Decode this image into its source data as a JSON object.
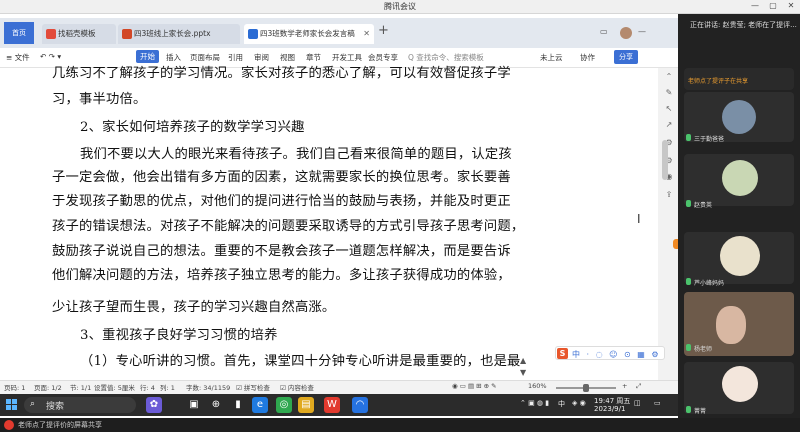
{
  "meeting": {
    "title": "腾讯会议",
    "minimize": "—",
    "maximize": "▢",
    "close": "✕"
  },
  "wps": {
    "home_tab": "首页",
    "tabs": [
      {
        "label": "找稻壳模板",
        "color": "#e24b3b"
      },
      {
        "label": "四3班线上家长会.pptx",
        "color": "#d24726"
      },
      {
        "label": "四3班数学老师家长会发言稿",
        "color": "#2b6cd4"
      }
    ],
    "tab_plus": "+",
    "menu_file": "≡ 文件",
    "menu": [
      "开始",
      "插入",
      "页面布局",
      "引用",
      "审阅",
      "视图",
      "章节",
      "开发工具",
      "会员专享"
    ],
    "search_hint": "Q 查找命令、搜索模板",
    "cloud": "未上云",
    "collab": "协作",
    "share": "分享"
  },
  "document": {
    "lines": [
      "几练习不了解孩子的学习情况。家长对孩子的悉心了解，可以有效督促孩子学",
      "习，事半功倍。",
      "2、家长如何培养孩子的数学学习兴趣",
      "我们不要以大人的眼光来看待孩子。我们自己看来很简单的题目，认定孩",
      "子一定会做，他会出错有多方面的因素，这就需要家长的换位思考。家长要善",
      "于发现孩子勤思的优点，对他们的提问进行恰当的鼓励与表扬，并能及时更正",
      "孩子的错误想法。对孩子不能解决的问题要采取诱导的方式引导孩子思考问题，",
      "鼓励孩子说说自己的想法。重要的不是教会孩子一道题怎样解决，而是要告诉",
      "他们解决问题的方法，培养孩子独立思考的能力。多让孩子获得成功的体验，",
      "少让孩子望而生畏，孩子的学习兴趣自然高涨。",
      "3、重视孩子良好学习习惯的培养",
      "（1）专心听讲的习惯。首先，课堂四十分钟专心听讲是最重要的，也是最"
    ],
    "ime": "中 · ◌ ☺ ⊙ ▦ ⚙"
  },
  "status": {
    "page": "页码: 1",
    "pages": "页面: 1/2",
    "section": "节: 1/1",
    "setting": "设置值: 5厘米",
    "row": "行: 4",
    "col": "列: 1",
    "words": "字数: 34/1159",
    "spell": "☑ 拼写检查",
    "content": "☑ 内容检查",
    "zoom": "160%",
    "zoom_level": 0.5
  },
  "taskbar": {
    "search": "搜索",
    "time": "19:47 周五",
    "date": "2023/9/1",
    "lang": "中"
  },
  "bottom": {
    "text": "老师点了提评价的屏幕共享"
  },
  "panel": {
    "header": "正在讲话: 赵贵莹; 老师在了提评...",
    "subheader": "老师点了提评子在共享",
    "participants": [
      {
        "name": "三于勤爸爸"
      },
      {
        "name": "赵贵英"
      },
      {
        "name": "芦小峰妈妈"
      },
      {
        "name": "杨老师"
      },
      {
        "name": "菁菁"
      }
    ]
  }
}
